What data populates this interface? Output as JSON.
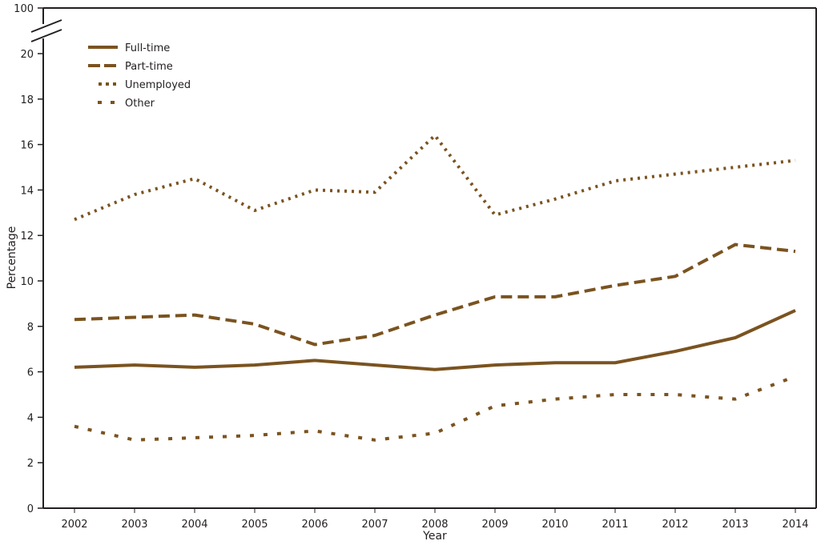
{
  "chart_data": {
    "type": "line",
    "title": "",
    "xlabel": "Year",
    "ylabel": "Percentage",
    "x": [
      2002,
      2003,
      2004,
      2005,
      2006,
      2007,
      2008,
      2009,
      2010,
      2011,
      2012,
      2013,
      2014
    ],
    "x_tick_labels": [
      "2002",
      "2003",
      "2004",
      "2005",
      "2006",
      "2007",
      "2008",
      "2009",
      "2010",
      "2011",
      "2012",
      "2013",
      "2014"
    ],
    "y_tick_labels": [
      "0",
      "2",
      "4",
      "6",
      "8",
      "10",
      "12",
      "14",
      "16",
      "18",
      "20",
      "100"
    ],
    "y_ticks": [
      0,
      2,
      4,
      6,
      8,
      10,
      12,
      14,
      16,
      18,
      20,
      100
    ],
    "ylim": [
      0,
      100
    ],
    "y_axis_break": [
      20,
      100
    ],
    "grid": false,
    "legend_position": "top-left",
    "line_color": "#7a5320",
    "series": [
      {
        "name": "Full-time",
        "style": "solid",
        "values": [
          6.2,
          6.3,
          6.2,
          6.3,
          6.5,
          6.3,
          6.1,
          6.3,
          6.4,
          6.4,
          6.9,
          7.5,
          8.7
        ]
      },
      {
        "name": "Part-time",
        "style": "dashed",
        "values": [
          8.3,
          8.4,
          8.5,
          8.1,
          7.2,
          7.6,
          8.5,
          9.3,
          9.3,
          9.8,
          10.2,
          11.6,
          11.3
        ]
      },
      {
        "name": "Unemployed",
        "style": "dotted",
        "values": [
          12.7,
          13.8,
          14.5,
          13.1,
          14.0,
          13.9,
          16.4,
          12.9,
          13.6,
          14.4,
          14.7,
          15.0,
          15.3
        ]
      },
      {
        "name": "Other",
        "style": "short-dashed",
        "values": [
          3.6,
          3.0,
          3.1,
          3.2,
          3.4,
          3.0,
          3.3,
          4.5,
          4.8,
          5.0,
          5.0,
          4.8,
          5.8
        ]
      }
    ]
  }
}
